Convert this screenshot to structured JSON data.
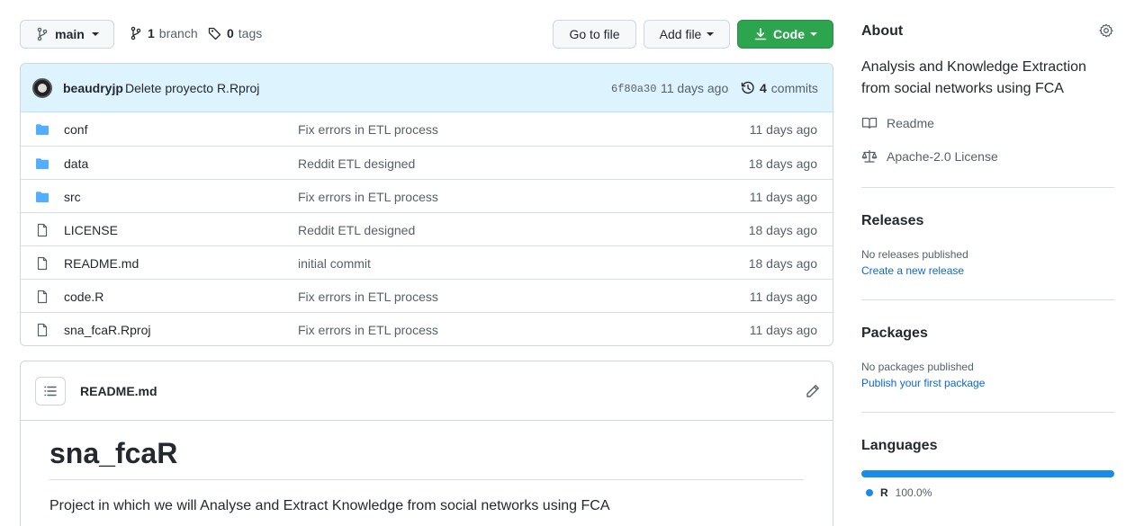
{
  "toolbar": {
    "branch_selector": "main",
    "branches_count": "1",
    "branches_label": "branch",
    "tags_count": "0",
    "tags_label": "tags",
    "go_to_file": "Go to file",
    "add_file": "Add file",
    "code": "Code"
  },
  "latest_commit": {
    "author": "beaudryjp",
    "message": "Delete proyecto R.Rproj",
    "sha": "6f80a30",
    "time": "11 days ago",
    "commits_count": "4",
    "commits_label": "commits"
  },
  "files": [
    {
      "name": "conf",
      "type": "folder",
      "message": "Fix errors in ETL process",
      "age": "11 days ago"
    },
    {
      "name": "data",
      "type": "folder",
      "message": "Reddit ETL designed",
      "age": "18 days ago"
    },
    {
      "name": "src",
      "type": "folder",
      "message": "Fix errors in ETL process",
      "age": "11 days ago"
    },
    {
      "name": "LICENSE",
      "type": "file",
      "message": "Reddit ETL designed",
      "age": "18 days ago"
    },
    {
      "name": "README.md",
      "type": "file",
      "message": "initial commit",
      "age": "18 days ago"
    },
    {
      "name": "code.R",
      "type": "file",
      "message": "Fix errors in ETL process",
      "age": "11 days ago"
    },
    {
      "name": "sna_fcaR.Rproj",
      "type": "file",
      "message": "Fix errors in ETL process",
      "age": "11 days ago"
    }
  ],
  "readme": {
    "filename": "README.md",
    "title": "sna_fcaR",
    "text": "Project in which we will Analyse and Extract Knowledge from social networks using FCA"
  },
  "sidebar": {
    "about_heading": "About",
    "description": "Analysis and Knowledge Extraction from social networks using FCA",
    "readme_link": "Readme",
    "license_link": "Apache-2.0 License",
    "releases_heading": "Releases",
    "releases_none": "No releases published",
    "releases_create": "Create a new release",
    "packages_heading": "Packages",
    "packages_none": "No packages published",
    "packages_publish": "Publish your first package",
    "languages_heading": "Languages",
    "language_name": "R",
    "language_percent": "100.0%",
    "language_color": "#198ce7"
  },
  "colors": {
    "accent_green": "#2da44e",
    "folder_blue": "#54aeff",
    "link_blue": "#0969da"
  }
}
